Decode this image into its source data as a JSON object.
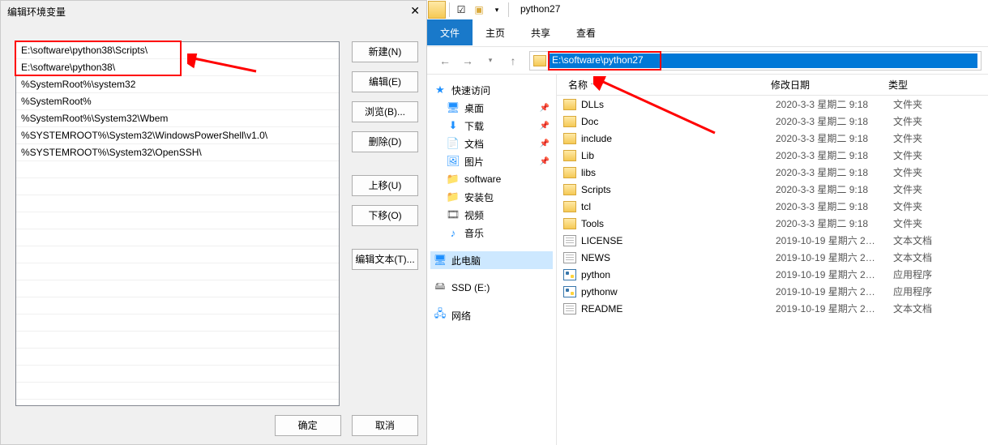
{
  "dialog": {
    "title": "编辑环境变量",
    "paths": [
      "E:\\software\\python38\\Scripts\\",
      "E:\\software\\python38\\",
      "%SystemRoot%\\system32",
      "%SystemRoot%",
      "%SystemRoot%\\System32\\Wbem",
      "%SYSTEMROOT%\\System32\\WindowsPowerShell\\v1.0\\",
      "%SYSTEMROOT%\\System32\\OpenSSH\\"
    ],
    "buttons": {
      "new": "新建(N)",
      "edit": "编辑(E)",
      "browse": "浏览(B)...",
      "delete": "删除(D)",
      "move_up": "上移(U)",
      "move_down": "下移(O)",
      "edit_text": "编辑文本(T)...",
      "ok": "确定",
      "cancel": "取消"
    }
  },
  "explorer": {
    "title": "python27",
    "tabs": {
      "file": "文件",
      "home": "主页",
      "share": "共享",
      "view": "查看"
    },
    "address": "E:\\software\\python27",
    "tree": {
      "quick": "快速访问",
      "desktop": "桌面",
      "downloads": "下载",
      "documents": "文档",
      "pictures": "图片",
      "software": "software",
      "packages": "安装包",
      "videos": "视频",
      "music": "音乐",
      "thispc": "此电脑",
      "ssd": "SSD (E:)",
      "network": "网络"
    },
    "columns": {
      "name": "名称",
      "date": "修改日期",
      "type": "类型"
    },
    "items": [
      {
        "name": "DLLs",
        "date": "2020-3-3 星期二 9:18",
        "type": "文件夹",
        "icon": "folder"
      },
      {
        "name": "Doc",
        "date": "2020-3-3 星期二 9:18",
        "type": "文件夹",
        "icon": "folder"
      },
      {
        "name": "include",
        "date": "2020-3-3 星期二 9:18",
        "type": "文件夹",
        "icon": "folder"
      },
      {
        "name": "Lib",
        "date": "2020-3-3 星期二 9:18",
        "type": "文件夹",
        "icon": "folder"
      },
      {
        "name": "libs",
        "date": "2020-3-3 星期二 9:18",
        "type": "文件夹",
        "icon": "folder"
      },
      {
        "name": "Scripts",
        "date": "2020-3-3 星期二 9:18",
        "type": "文件夹",
        "icon": "folder"
      },
      {
        "name": "tcl",
        "date": "2020-3-3 星期二 9:18",
        "type": "文件夹",
        "icon": "folder"
      },
      {
        "name": "Tools",
        "date": "2020-3-3 星期二 9:18",
        "type": "文件夹",
        "icon": "folder"
      },
      {
        "name": "LICENSE",
        "date": "2019-10-19 星期六 2…",
        "type": "文本文档",
        "icon": "file"
      },
      {
        "name": "NEWS",
        "date": "2019-10-19 星期六 2…",
        "type": "文本文档",
        "icon": "file"
      },
      {
        "name": "python",
        "date": "2019-10-19 星期六 2…",
        "type": "应用程序",
        "icon": "py"
      },
      {
        "name": "pythonw",
        "date": "2019-10-19 星期六 2…",
        "type": "应用程序",
        "icon": "py"
      },
      {
        "name": "README",
        "date": "2019-10-19 星期六 2…",
        "type": "文本文档",
        "icon": "file"
      }
    ]
  }
}
